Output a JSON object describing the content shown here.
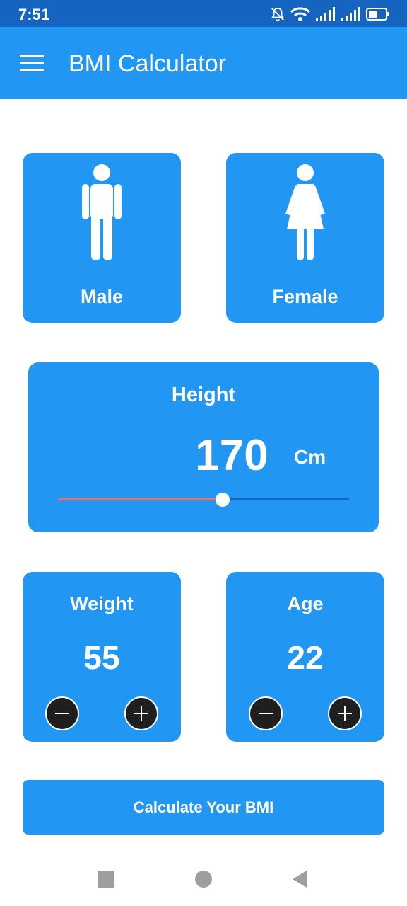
{
  "status_bar": {
    "time": "7:51",
    "icons": [
      "notifications-off-icon",
      "wifi-icon",
      "signal-icon",
      "signal-icon",
      "battery-icon"
    ]
  },
  "app_bar": {
    "title": "BMI Calculator",
    "menu_icon": "hamburger-menu-icon"
  },
  "gender": {
    "male": {
      "label": "Male",
      "icon": "male-figure-icon"
    },
    "female": {
      "label": "Female",
      "icon": "female-figure-icon"
    }
  },
  "height": {
    "label": "Height",
    "value": "170",
    "unit": "Cm",
    "slider_fraction": 0.565
  },
  "weight": {
    "label": "Weight",
    "value": "55"
  },
  "age": {
    "label": "Age",
    "value": "22"
  },
  "calculate_button": {
    "label": "Calculate Your BMI"
  },
  "colors": {
    "status_bar": "#1565c0",
    "primary": "#2196f3",
    "slider_fill": "#e57373",
    "button_dark": "#1f1f1f",
    "text": "#ffffff"
  },
  "nav_bar": {
    "icons": [
      "recents-square-icon",
      "home-circle-icon",
      "back-triangle-icon"
    ]
  }
}
